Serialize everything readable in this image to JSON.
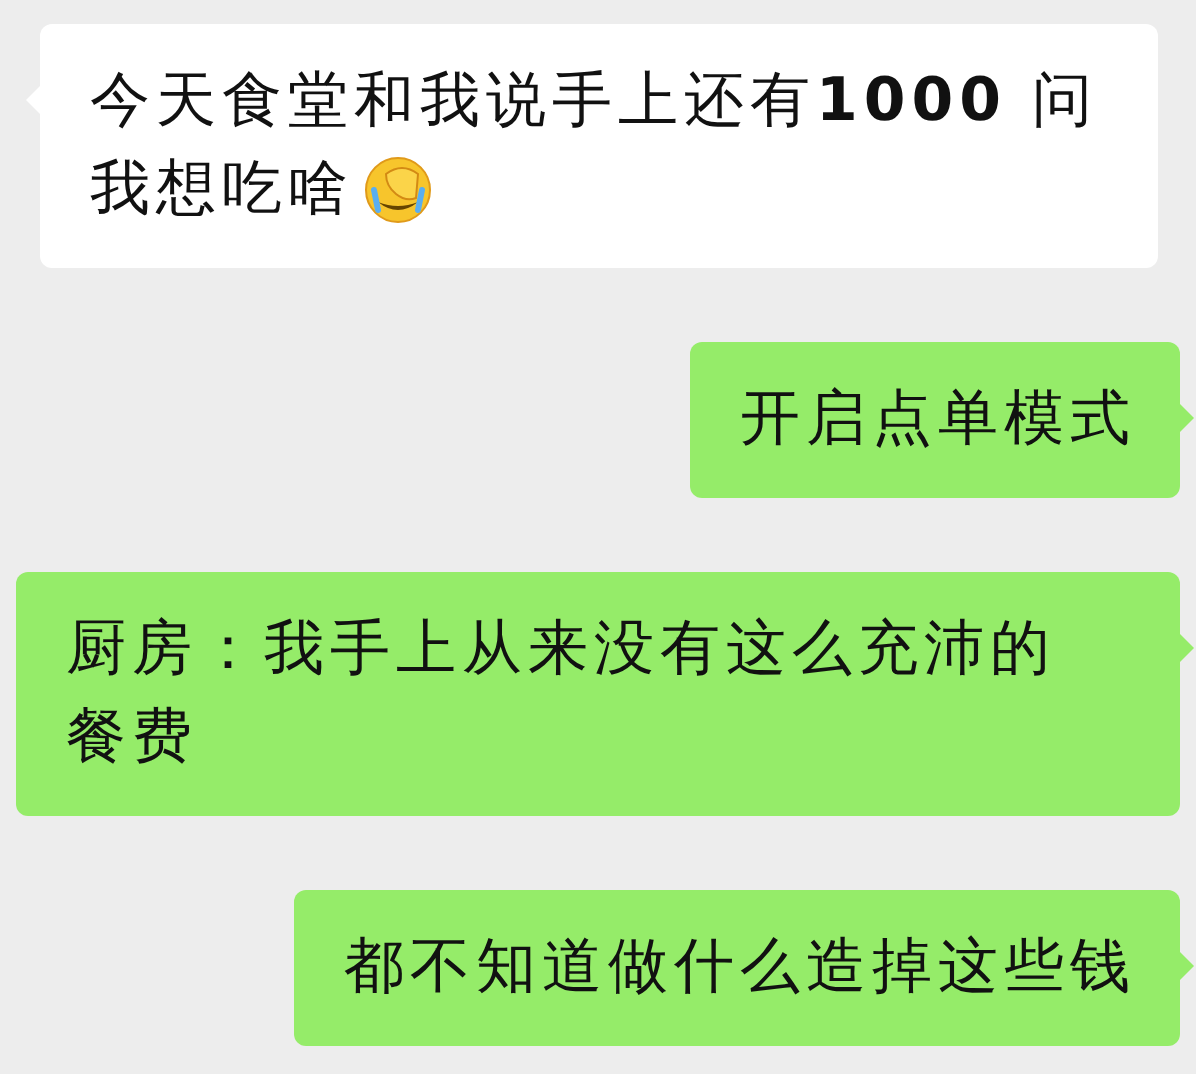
{
  "messages": [
    {
      "kind": "incoming",
      "lines": [
        "今天食堂和我说手上还有**1000** 问",
        "我想吃啥"
      ],
      "emoji": true
    },
    {
      "kind": "outgoing",
      "lines": [
        "开启点单模式"
      ],
      "emoji": false
    },
    {
      "kind": "outgoing",
      "lines": [
        "厨房：我手上从来没有这么充沛的",
        "餐费"
      ],
      "emoji": false
    },
    {
      "kind": "outgoing",
      "lines": [
        "都不知道做什么造掉这些钱"
      ],
      "emoji": false
    }
  ]
}
